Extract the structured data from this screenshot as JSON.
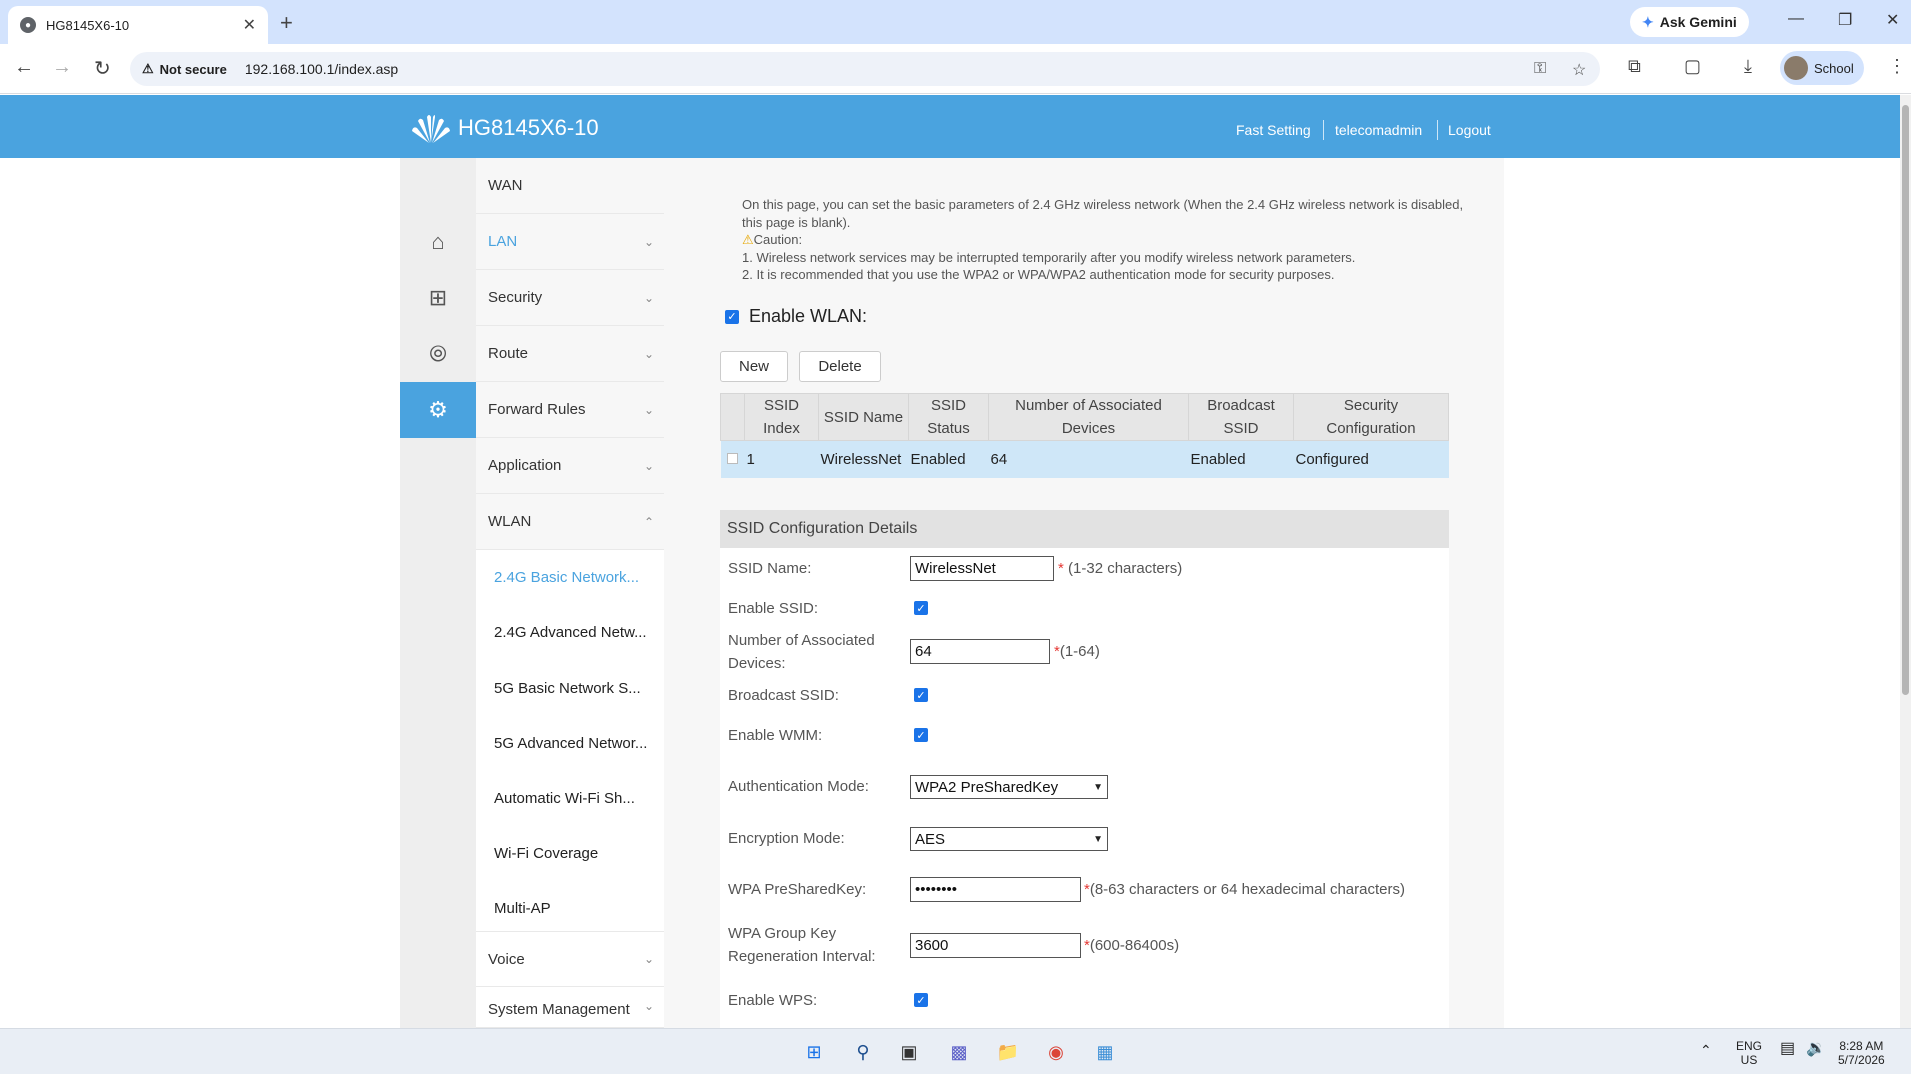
{
  "browser": {
    "tab_title": "HG8145X6-10",
    "new_tab": "+",
    "ask_gemini": "Ask Gemini",
    "not_secure": "Not secure",
    "url": "192.168.100.1/index.asp",
    "profile": "School"
  },
  "header": {
    "model": "HG8145X6-10",
    "fast_setting": "Fast Setting",
    "user": "telecomadmin",
    "logout": "Logout"
  },
  "menu": {
    "items": [
      {
        "label": "WAN",
        "chev": ""
      },
      {
        "label": "LAN",
        "chev": "⌄"
      },
      {
        "label": "Security",
        "chev": "⌄"
      },
      {
        "label": "Route",
        "chev": "⌄"
      },
      {
        "label": "Forward Rules",
        "chev": "⌄"
      },
      {
        "label": "Application",
        "chev": "⌄"
      },
      {
        "label": "WLAN",
        "chev": "⌃"
      },
      {
        "label": "Voice",
        "chev": "⌄"
      },
      {
        "label": "System Management",
        "chev": "⌄"
      }
    ],
    "wlan_sub": [
      "2.4G Basic Network...",
      "2.4G Advanced Netw...",
      "5G Basic Network S...",
      "5G Advanced Networ...",
      "Automatic Wi-Fi Sh...",
      "Wi-Fi Coverage",
      "Multi-AP"
    ]
  },
  "info": {
    "line1": "On this page, you can set the basic parameters of 2.4 GHz wireless network (When the 2.4 GHz wireless network is disabled, this page is blank).",
    "caution": "Caution:",
    "note1": "1. Wireless network services may be interrupted temporarily after you modify wireless network parameters.",
    "note2": "2. It is recommended that you use the WPA2 or WPA/WPA2 authentication mode for security purposes."
  },
  "enable_wlan": {
    "label": "Enable WLAN:",
    "checked": true
  },
  "buttons": {
    "new": "New",
    "delete": "Delete"
  },
  "ssid_table": {
    "headers": [
      {
        "l1": "SSID",
        "l2": "Index"
      },
      {
        "l1": "SSID Name",
        "l2": ""
      },
      {
        "l1": "SSID",
        "l2": "Status"
      },
      {
        "l1": "Number of Associated",
        "l2": "Devices"
      },
      {
        "l1": "Broadcast",
        "l2": "SSID"
      },
      {
        "l1": "Security",
        "l2": "Configuration"
      }
    ],
    "rows": [
      {
        "index": "1",
        "name": "WirelessNet",
        "status": "Enabled",
        "devices": "64",
        "broadcast": "Enabled",
        "security": "Configured"
      }
    ]
  },
  "details": {
    "title": "SSID Configuration Details",
    "ssid_name_label": "SSID Name:",
    "ssid_name_value": "WirelessNet",
    "ssid_name_hint": "(1-32 characters)",
    "enable_ssid_label": "Enable SSID:",
    "assoc_label_1": "Number of Associated",
    "assoc_label_2": "Devices:",
    "assoc_value": "64",
    "assoc_hint": "(1-64)",
    "broadcast_label": "Broadcast SSID:",
    "wmm_label": "Enable WMM:",
    "auth_label": "Authentication Mode:",
    "auth_value": "WPA2 PreSharedKey",
    "enc_label": "Encryption Mode:",
    "enc_value": "AES",
    "psk_label": "WPA PreSharedKey:",
    "psk_value": "••••••••",
    "psk_hint": "(8-63 characters or 64 hexadecimal characters)",
    "regen_label_1": "WPA Group Key",
    "regen_label_2": "Regeneration Interval:",
    "regen_value": "3600",
    "regen_hint": "(600-86400s)",
    "wps_label": "Enable WPS:",
    "required_mark": "*"
  },
  "taskbar": {
    "lang_1": "ENG",
    "lang_2": "US",
    "time": "8:28 AM",
    "date": "5/7/2026"
  },
  "colors": {
    "header_blue": "#4aa3df",
    "row_highlight": "#cfe7f8",
    "checkbox_blue": "#1a73e8"
  }
}
